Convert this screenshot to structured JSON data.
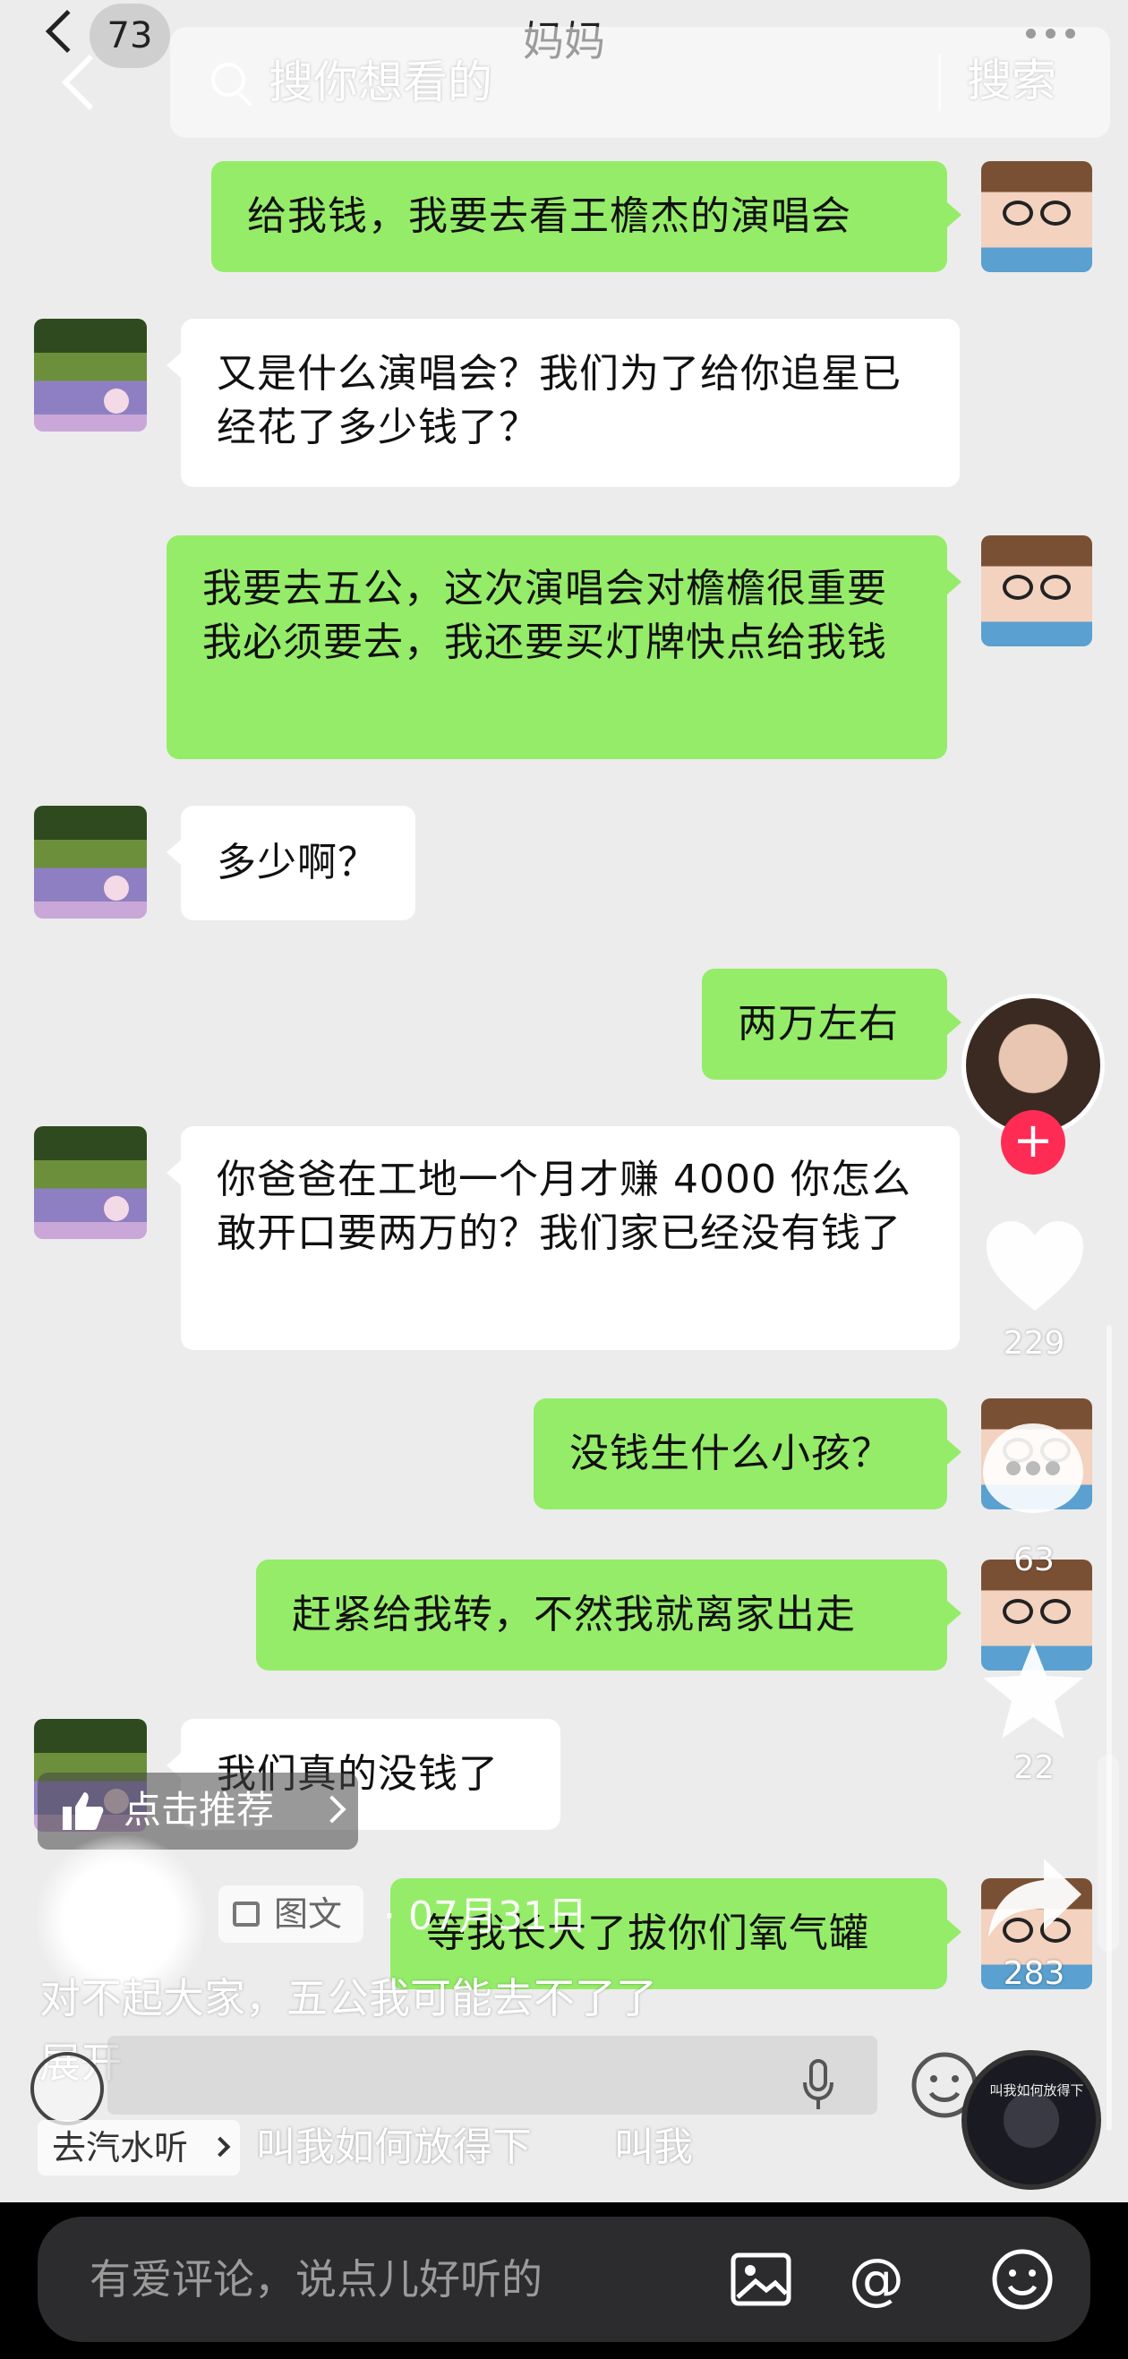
{
  "header": {
    "unread_count": "73",
    "chat_title": "妈妈"
  },
  "search": {
    "placeholder": "搜你想看的",
    "button_label": "搜索"
  },
  "messages": [
    {
      "from": "me",
      "text": "给我钱，我要去看王檐杰的演唱会"
    },
    {
      "from": "mom",
      "text": "又是什么演唱会？我们为了给你追星已经花了多少钱了？"
    },
    {
      "from": "me",
      "text": "我要去五公，这次演唱会对檐檐很重要我必须要去，我还要买灯牌快点给我钱"
    },
    {
      "from": "mom",
      "text": "多少啊？"
    },
    {
      "from": "me",
      "text": "两万左右"
    },
    {
      "from": "mom",
      "text": "你爸爸在工地一个月才赚 4000 你怎么敢开口要两万的？我们家已经没有钱了"
    },
    {
      "from": "me",
      "text": "没钱生什么小孩？"
    },
    {
      "from": "me",
      "text": "赶紧给我转，不然我就离家出走"
    },
    {
      "from": "mom",
      "text": "我们真的没钱了"
    },
    {
      "from": "me",
      "text": "等我长大了拔你们氧气罐"
    }
  ],
  "rail": {
    "likes": "229",
    "comments": "63",
    "favorites": "22",
    "shares": "283",
    "follow_symbol": "+"
  },
  "post": {
    "recommend_label": "点击推荐",
    "type_tag": "图文",
    "date": "· 07月31日",
    "caption": "对不起大家，五公我可能去不了了",
    "expand": "展开"
  },
  "music": {
    "tag": "去汽水听",
    "title": "叫我如何放得下",
    "title_repeat": "叫我",
    "disc_text": "叫我如何放得下"
  },
  "comment_bar": {
    "placeholder": "有爱评论，说点儿好听的",
    "at_symbol": "@"
  },
  "colors": {
    "my_bubble": "#95ec69",
    "mom_bubble": "#ffffff",
    "follow_red": "#fe2c55",
    "chat_bg": "#ececec"
  },
  "icons": [
    "back-icon",
    "search-icon",
    "more-icon",
    "heart-icon",
    "comment-icon",
    "star-icon",
    "share-icon",
    "thumb-up-icon",
    "image-icon",
    "at-icon",
    "emoji-icon",
    "mic-icon",
    "sound-icon"
  ]
}
